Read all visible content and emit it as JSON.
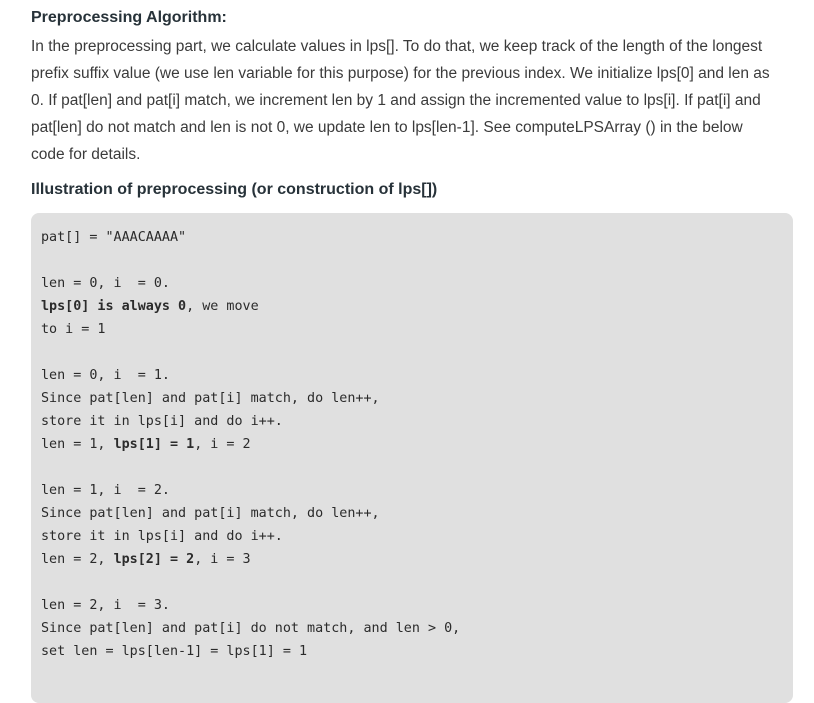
{
  "section": {
    "heading": "Preprocessing Algorithm:",
    "paragraph_lines": [
      "In the preprocessing part, we calculate values in lps[]. To do that, we keep track of the length of the longest",
      "prefix suffix value (we use len variable for this purpose) for the previous index. We initialize lps[0] and len as",
      "0. If pat[len] and pat[i] match, we increment len by 1 and assign the incremented value to lps[i]. If pat[i] and",
      "pat[len] do not match and len is not 0, we update len to lps[len-1]. See computeLPSArray () in the below",
      "code for details."
    ],
    "illustration_heading": "Illustration of preprocessing (or construction of lps[])"
  },
  "code_lines": [
    {
      "parts": [
        {
          "t": "pat[] = \"AAACAAAA\"",
          "b": false
        }
      ]
    },
    {
      "parts": [
        {
          "t": "",
          "b": false
        }
      ]
    },
    {
      "parts": [
        {
          "t": "len = 0, i  = 0.",
          "b": false
        }
      ]
    },
    {
      "parts": [
        {
          "t": "lps[0] is always 0",
          "b": true
        },
        {
          "t": ", we move",
          "b": false
        }
      ]
    },
    {
      "parts": [
        {
          "t": "to i = 1",
          "b": false
        }
      ]
    },
    {
      "parts": [
        {
          "t": "",
          "b": false
        }
      ]
    },
    {
      "parts": [
        {
          "t": "len = 0, i  = 1.",
          "b": false
        }
      ]
    },
    {
      "parts": [
        {
          "t": "Since pat[len] and pat[i] match, do len++,",
          "b": false
        }
      ]
    },
    {
      "parts": [
        {
          "t": "store it in lps[i] and do i++.",
          "b": false
        }
      ]
    },
    {
      "parts": [
        {
          "t": "len = 1, ",
          "b": false
        },
        {
          "t": "lps[1] = 1",
          "b": true
        },
        {
          "t": ", i = 2",
          "b": false
        }
      ]
    },
    {
      "parts": [
        {
          "t": "",
          "b": false
        }
      ]
    },
    {
      "parts": [
        {
          "t": "len = 1, i  = 2.",
          "b": false
        }
      ]
    },
    {
      "parts": [
        {
          "t": "Since pat[len] and pat[i] match, do len++,",
          "b": false
        }
      ]
    },
    {
      "parts": [
        {
          "t": "store it in lps[i] and do i++.",
          "b": false
        }
      ]
    },
    {
      "parts": [
        {
          "t": "len = 2, ",
          "b": false
        },
        {
          "t": "lps[2] = 2",
          "b": true
        },
        {
          "t": ", i = 3",
          "b": false
        }
      ]
    },
    {
      "parts": [
        {
          "t": "",
          "b": false
        }
      ]
    },
    {
      "parts": [
        {
          "t": "len = 2, i  = 3.",
          "b": false
        }
      ]
    },
    {
      "parts": [
        {
          "t": "Since pat[len] and pat[i] do not match, and len > 0,",
          "b": false
        }
      ]
    },
    {
      "parts": [
        {
          "t": "set len = lps[len-1] = lps[1] = 1",
          "b": false
        }
      ]
    }
  ]
}
